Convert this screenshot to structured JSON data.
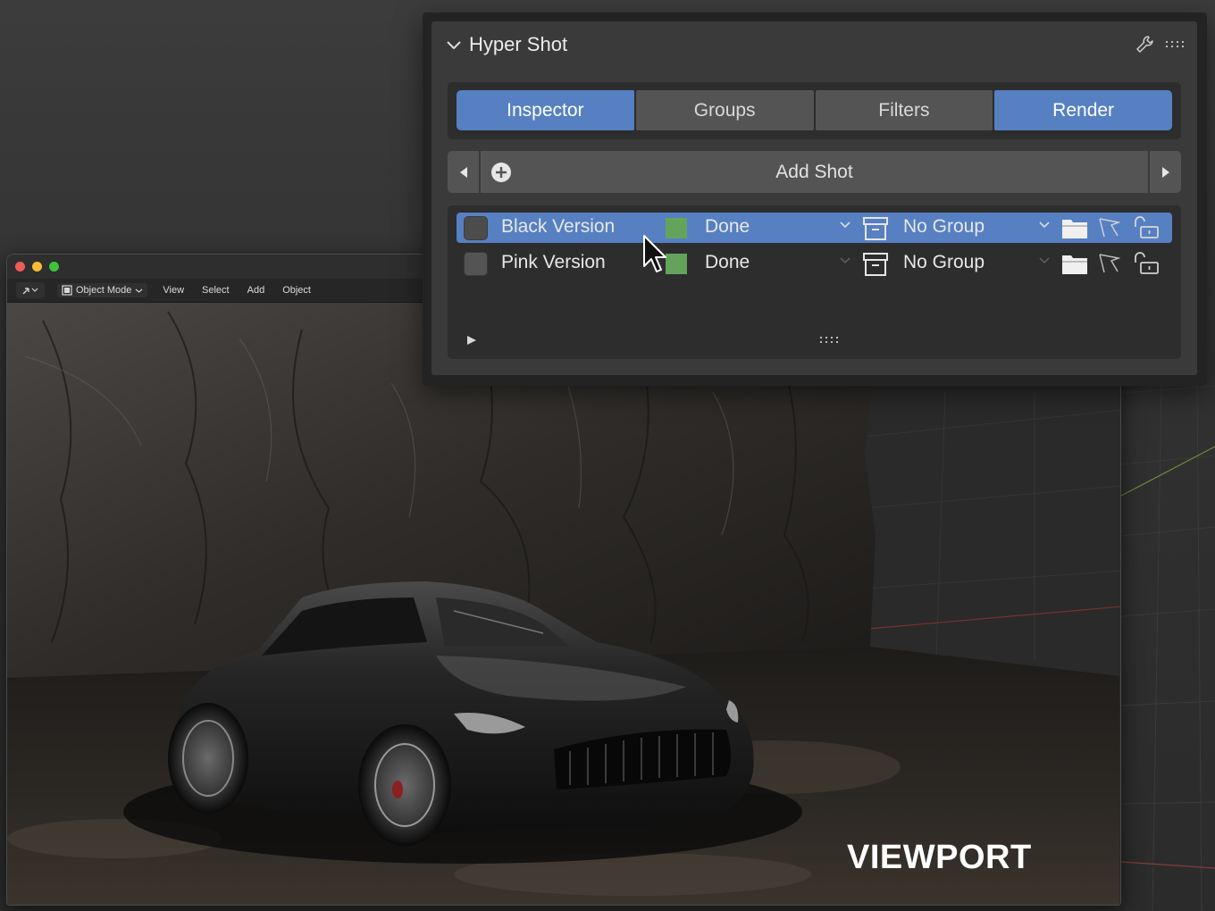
{
  "panel": {
    "title": "Hyper Shot",
    "tabs": [
      {
        "label": "Inspector",
        "active": true
      },
      {
        "label": "Groups",
        "active": false
      },
      {
        "label": "Filters",
        "active": false
      },
      {
        "label": "Render",
        "active": true
      }
    ],
    "add_shot_label": "Add Shot",
    "shots": [
      {
        "name": "Black Version",
        "status": "Done",
        "group": "No Group",
        "selected": true,
        "color": "#64a35c"
      },
      {
        "name": "Pink Version",
        "status": "Done",
        "group": "No Group",
        "selected": false,
        "color": "#64a35c"
      }
    ]
  },
  "viewport": {
    "mode": "Object Mode",
    "menus": [
      "View",
      "Select",
      "Add",
      "Object"
    ],
    "label": "VIEWPORT"
  },
  "colors": {
    "accent": "#5680c2",
    "status_done": "#64a35c",
    "panel_bg": "#3a3a3a"
  },
  "icons": {
    "header": [
      "wrench-icon",
      "drag-grip-icon"
    ],
    "row": [
      "archive-icon",
      "folder-icon",
      "select-cursor-icon",
      "unlock-icon"
    ]
  }
}
